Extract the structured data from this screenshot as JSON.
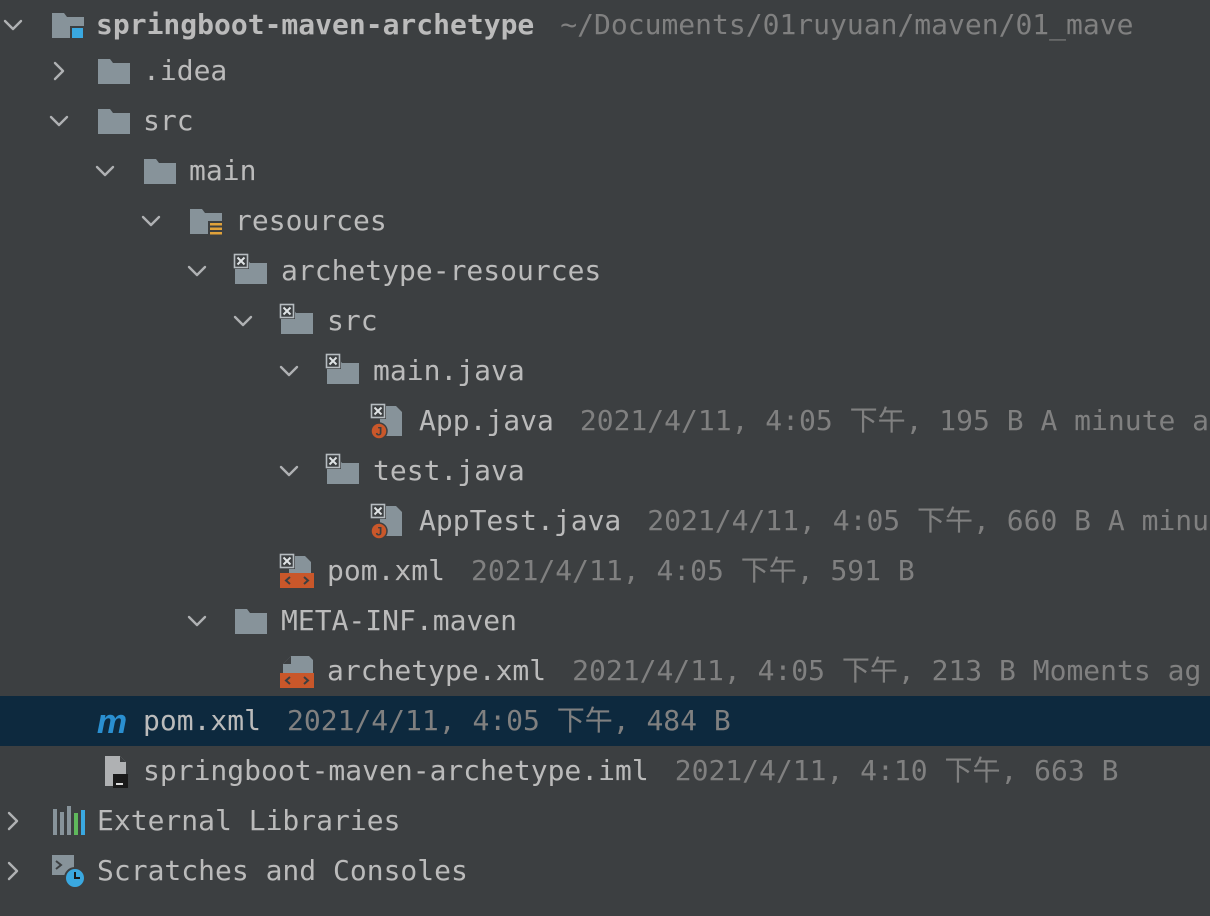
{
  "tree": {
    "rows": [
      {
        "name": "springboot-maven-archetype",
        "meta": "~/Documents/01ruyuan/maven/01_mave"
      },
      {
        "name": ".idea",
        "meta": ""
      },
      {
        "name": "src",
        "meta": ""
      },
      {
        "name": "main",
        "meta": ""
      },
      {
        "name": "resources",
        "meta": ""
      },
      {
        "name": "archetype-resources",
        "meta": ""
      },
      {
        "name": "src",
        "meta": ""
      },
      {
        "name": "main.java",
        "meta": ""
      },
      {
        "name": "App.java",
        "meta": "2021/4/11, 4:05 下午, 195 B A minute a"
      },
      {
        "name": "test.java",
        "meta": ""
      },
      {
        "name": "AppTest.java",
        "meta": "2021/4/11, 4:05 下午, 660 B A minu"
      },
      {
        "name": "pom.xml",
        "meta": "2021/4/11, 4:05 下午, 591 B"
      },
      {
        "name": "META-INF.maven",
        "meta": ""
      },
      {
        "name": "archetype.xml",
        "meta": "2021/4/11, 4:05 下午, 213 B Moments ag"
      },
      {
        "name": "pom.xml",
        "meta": "2021/4/11, 4:05 下午, 484 B"
      },
      {
        "name": "springboot-maven-archetype.iml",
        "meta": "2021/4/11, 4:10 下午, 663 B"
      },
      {
        "name": "External Libraries",
        "meta": ""
      },
      {
        "name": "Scratches and Consoles",
        "meta": ""
      }
    ]
  },
  "colors": {
    "background": "#3c3f41",
    "selection": "#0d293e",
    "text": "#bbbbbb",
    "meta_text": "#808080",
    "folder": "#87939a",
    "module_accent": "#3aa8e0",
    "xml_orange": "#c9572a",
    "maven_blue": "#2a8fd0"
  }
}
